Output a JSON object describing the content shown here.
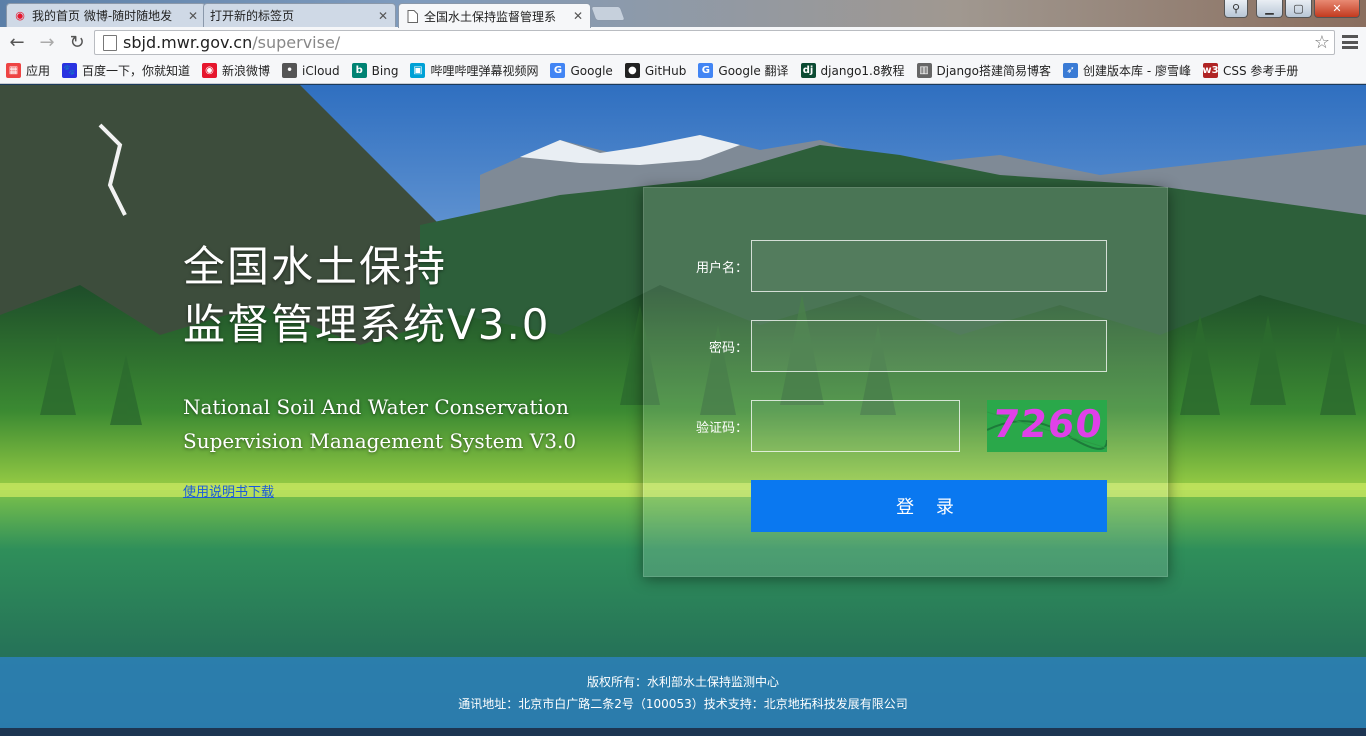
{
  "browser": {
    "tabs": [
      {
        "title": "我的首页 微博-随时随地发",
        "icon": "weibo-icon",
        "active": false
      },
      {
        "title": "打开新的标签页",
        "icon": "",
        "active": false
      },
      {
        "title": "全国水土保持监督管理系",
        "icon": "page-icon",
        "active": true
      }
    ],
    "address": {
      "host": "sbjd.mwr.gov.cn",
      "path": "/supervise/"
    },
    "bookmarks": [
      {
        "label": "应用",
        "icon": "apps-icon",
        "color": "#e44"
      },
      {
        "label": "百度一下，你就知道",
        "icon": "baidu-icon",
        "color": "#2932e1"
      },
      {
        "label": "新浪微博",
        "icon": "weibo-icon",
        "color": "#e6162d"
      },
      {
        "label": "iCloud",
        "icon": "apple-icon",
        "color": "#555555"
      },
      {
        "label": "Bing",
        "icon": "bing-icon",
        "color": "#008373"
      },
      {
        "label": "哔哩哔哩弹幕视频网",
        "icon": "bilibili-icon",
        "color": "#00a1d6"
      },
      {
        "label": "Google",
        "icon": "google-icon",
        "color": "#4285f4"
      },
      {
        "label": "GitHub",
        "icon": "github-icon",
        "color": "#222222"
      },
      {
        "label": "Google 翻译",
        "icon": "google-translate-icon",
        "color": "#4285f4"
      },
      {
        "label": "django1.8教程",
        "icon": "django-icon",
        "color": "#0c4b33"
      },
      {
        "label": "Django搭建简易博客",
        "icon": "book-icon",
        "color": "#666666"
      },
      {
        "label": "创建版本库 - 廖雪峰",
        "icon": "rocket-icon",
        "color": "#3a7bd5"
      },
      {
        "label": "CSS 参考手册",
        "icon": "w3school-icon",
        "color": "#b02424"
      }
    ]
  },
  "page": {
    "title_line1": "全国水土保持",
    "title_line2": "监督管理系统V3.0",
    "subtitle_line1": "National Soil And Water Conservation",
    "subtitle_line2": "Supervision Management System V3.0",
    "manual_link": "使用说明书下载"
  },
  "login": {
    "username_label": "用户名：",
    "password_label": "密码：",
    "captcha_label": "验证码：",
    "username_value": "",
    "password_value": "",
    "captcha_value": "",
    "captcha_code": "7260",
    "submit_label": "登 录"
  },
  "footer": {
    "copyright": "版权所有：水利部水土保持监测中心",
    "contact": "通讯地址：北京市白广路二条2号（100053）技术支持：北京地拓科技发展有限公司"
  }
}
